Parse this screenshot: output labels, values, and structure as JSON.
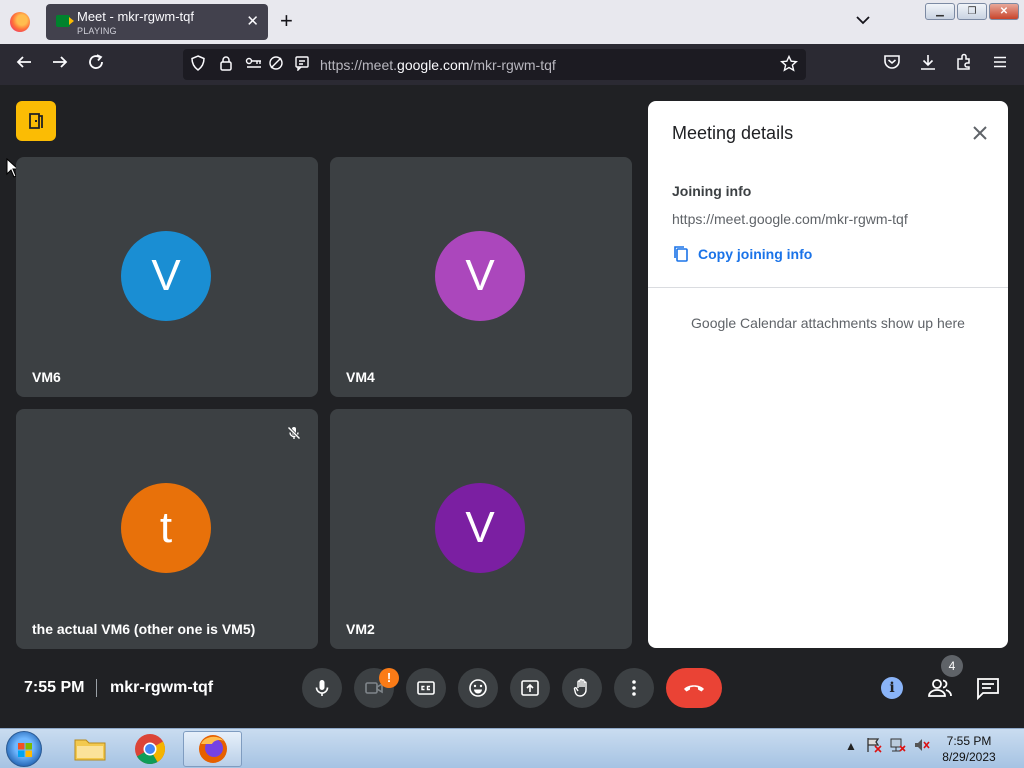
{
  "browser": {
    "tab": {
      "title": "Meet - mkr-rgwm-tqf",
      "subtitle": "PLAYING",
      "close_glyph": "✕"
    },
    "new_tab_glyph": "+",
    "url": {
      "scheme": "https://meet.",
      "host": "google.com",
      "path": "/mkr-rgwm-tqf"
    },
    "window_controls": [
      "minimize",
      "restore",
      "close"
    ]
  },
  "meet": {
    "tiles": [
      {
        "name": "VM6",
        "initial": "V",
        "color": "#1a8ed3",
        "muted": false
      },
      {
        "name": "VM4",
        "initial": "V",
        "color": "#ab47bc",
        "muted": false
      },
      {
        "name": "the actual VM6 (other one is VM5)",
        "initial": "t",
        "color": "#e8710a",
        "muted": true
      },
      {
        "name": "VM2",
        "initial": "V",
        "color": "#7b1fa2",
        "muted": false
      }
    ],
    "panel": {
      "title": "Meeting details",
      "joining_label": "Joining info",
      "joining_url": "https://meet.google.com/mkr-rgwm-tqf",
      "copy_label": "Copy joining info",
      "calendar_note": "Google Calendar attachments show up here"
    },
    "bottom_bar": {
      "time": "7:55 PM",
      "meeting_code": "mkr-rgwm-tqf",
      "camera_warning": "!",
      "info_glyph": "i",
      "participant_count": "4"
    }
  },
  "taskbar": {
    "time": "7:55 PM",
    "date": "8/29/2023",
    "tray_arrow": "▲"
  },
  "colors": {
    "meet_bg": "#202124",
    "tile_bg": "#3c4043",
    "end_call": "#ea4335",
    "accent_blue": "#1a73e8",
    "leave_hint": "#fbbc04"
  }
}
